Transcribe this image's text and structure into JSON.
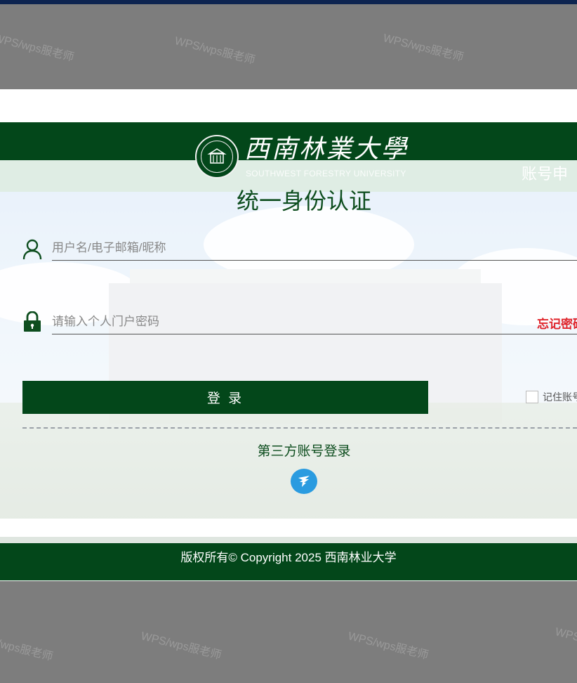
{
  "header": {
    "university_name": "西南林業大學",
    "university_name_en": "SOUTHWEST FORESTRY UNIVERSITY",
    "apply_link": "账号申"
  },
  "login": {
    "title": "统一身份认证",
    "username_placeholder": "用户名/电子邮箱/昵称",
    "password_placeholder": "请输入个人门户密码",
    "forgot_link": "忘记密码",
    "login_button": "登 录",
    "remember_label": "记住账号",
    "third_party_title": "第三方账号登录"
  },
  "footer": {
    "copyright": "版权所有© Copyright 2025  西南林业大学"
  },
  "watermark": {
    "text": "WPS/wps服老师"
  },
  "colors": {
    "primary_green": "#03471a",
    "title_green": "#0d4d1e",
    "forgot_red": "#e0242b",
    "third_party_blue": "#2a9be0"
  }
}
